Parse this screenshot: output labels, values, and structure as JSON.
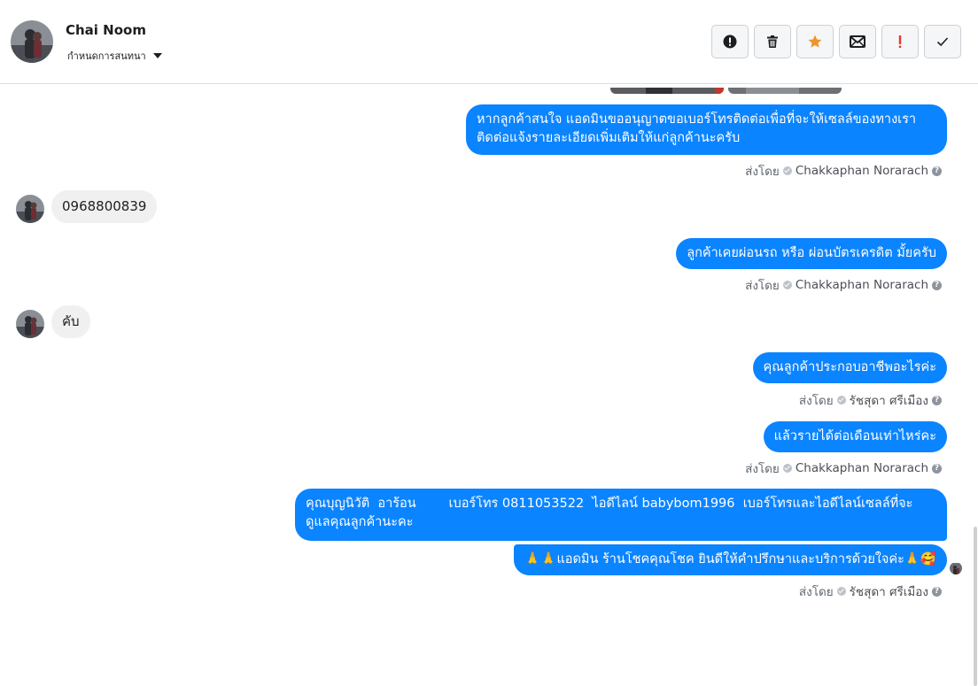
{
  "header": {
    "contact_name": "Chai Noom",
    "conversation_settings_label": "กำหนดการสนทนา",
    "toolbar_buttons": [
      {
        "name": "alert-button",
        "icon": "alert-circle-icon"
      },
      {
        "name": "delete-button",
        "icon": "trash-icon"
      },
      {
        "name": "star-button",
        "icon": "star-icon",
        "color": "#f0932b"
      },
      {
        "name": "mail-button",
        "icon": "envelope-icon"
      },
      {
        "name": "important-button",
        "icon": "exclamation-icon",
        "color": "#e4382f"
      },
      {
        "name": "done-button",
        "icon": "check-icon"
      }
    ]
  },
  "messages": [
    {
      "type": "out",
      "text_line1": "หากลูกค้าสนใจ แอดมินขออนุญาตขอเบอร์โทรติดต่อเพื่อที่จะให้เซลล์ของทางเรา",
      "text_line2": "ติดต่อแจ้งรายละเอียดเพิ่มเติมให้แก่ลูกค้านะครับ"
    },
    {
      "type": "sentby",
      "prefix": "ส่งโดย",
      "name": "Chakkaphan Norarach"
    },
    {
      "type": "in",
      "text": "0968800839"
    },
    {
      "type": "out",
      "text": "ลูกค้าเคยผ่อนรถ หรือ ผ่อนบัตรเครดิต มั้ยครับ"
    },
    {
      "type": "sentby",
      "prefix": "ส่งโดย",
      "name": "Chakkaphan Norarach"
    },
    {
      "type": "in",
      "text": "คับ"
    },
    {
      "type": "out",
      "text": "คุณลูกค้าประกอบอาชีพอะไรค่ะ"
    },
    {
      "type": "sentby",
      "prefix": "ส่งโดย",
      "name": "รัชสุดา ศรีเมือง"
    },
    {
      "type": "out",
      "text": "แล้วรายได้ต่อเดือนเท่าไหร่คะ"
    },
    {
      "type": "sentby",
      "prefix": "ส่งโดย",
      "name": "Chakkaphan Norarach"
    },
    {
      "type": "out",
      "text_line1": "คุณบุญนิวัติ  อาร้อน        เบอร์โทร 0811053522  ไอดีไลน์ babybom1996  เบอร์โทรและไอดีไลน์เซลล์ที่จะ",
      "text_line2": "ดูแลคุณลูกค้านะคะ"
    },
    {
      "type": "out",
      "text": "🙏🙏แอดมิน ร้านโชคคุณโชค ยินดีให้คำปรึกษาและบริการด้วยใจค่ะ🙏🥰"
    },
    {
      "type": "sentby",
      "prefix": "ส่งโดย",
      "name": "รัชสุดา ศรีเมือง"
    }
  ]
}
